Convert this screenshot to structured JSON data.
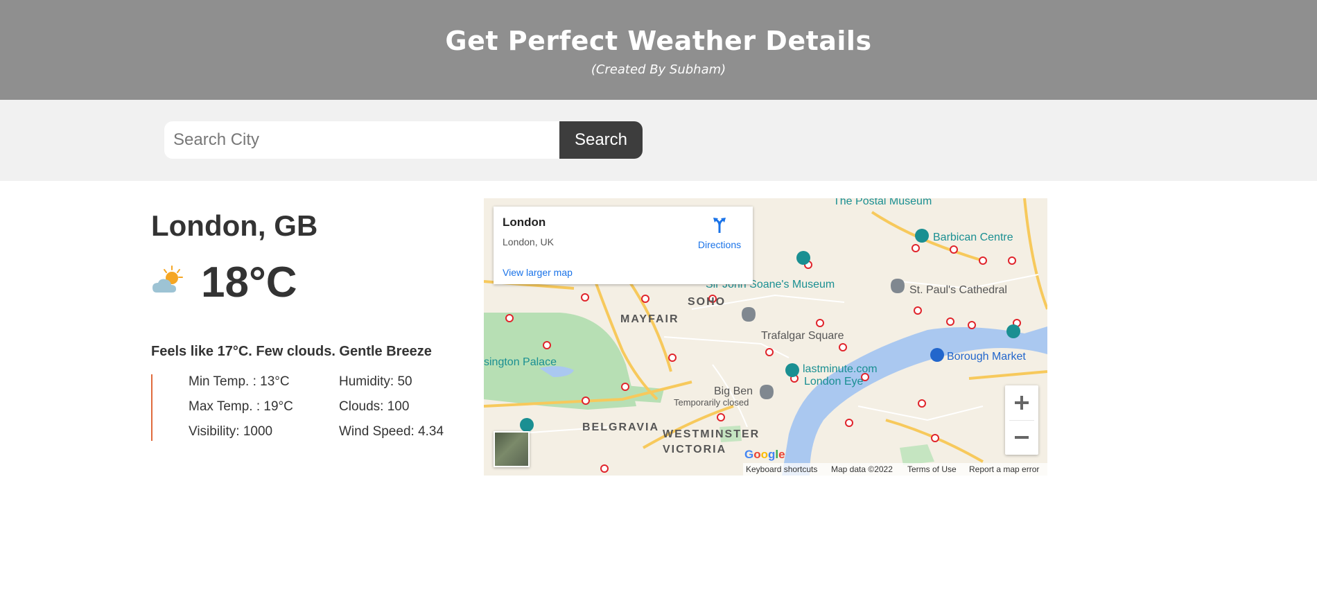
{
  "header": {
    "title": "Get Perfect Weather Details",
    "subtitle": "(Created By Subham)"
  },
  "search": {
    "placeholder": "Search City",
    "button_label": "Search"
  },
  "weather": {
    "city": "London, GB",
    "temperature": "18°C",
    "icon": "partly-cloudy-icon",
    "feels_like": "Feels like 17°C. Few clouds. Gentle Breeze",
    "min_temp": "Min Temp. : 13°C",
    "max_temp": "Max Temp. : 19°C",
    "visibility": "Visibility: 1000",
    "humidity": "Humidity: 50",
    "clouds": "Clouds: 100",
    "wind_speed": "Wind Speed: 4.34"
  },
  "map": {
    "card_title": "London",
    "card_subtitle": "London, UK",
    "directions_label": "Directions",
    "view_larger": "View larger map",
    "zoom_in": "+",
    "zoom_out": "−",
    "logo": "Google",
    "attribution": {
      "shortcuts": "Keyboard shortcuts",
      "data": "Map data ©2022",
      "terms": "Terms of Use",
      "report": "Report a map error"
    },
    "labels": {
      "mayfair": "MAYFAIR",
      "soho": "SOHO",
      "belgravia": "BELGRAVIA",
      "westminster": "WESTMINSTER",
      "victoria": "VICTORIA",
      "trafalgar": "Trafalgar Square",
      "big_ben": "Big Ben",
      "temp_closed": "Temporarily closed",
      "london_eye_1": "lastminute.com",
      "london_eye_2": "London Eye",
      "borough": "Borough Market",
      "st_pauls": "St. Paul's Cathedral",
      "barbican": "Barbican Centre",
      "postal": "The Postal Museum",
      "soane": "Sir John Soane's Museum",
      "kensington": "sington Palace"
    },
    "colors": {
      "water": "#aac8f0",
      "park": "#b7dfb4",
      "road_major": "#f7c95c",
      "land": "#f4efe4"
    }
  }
}
